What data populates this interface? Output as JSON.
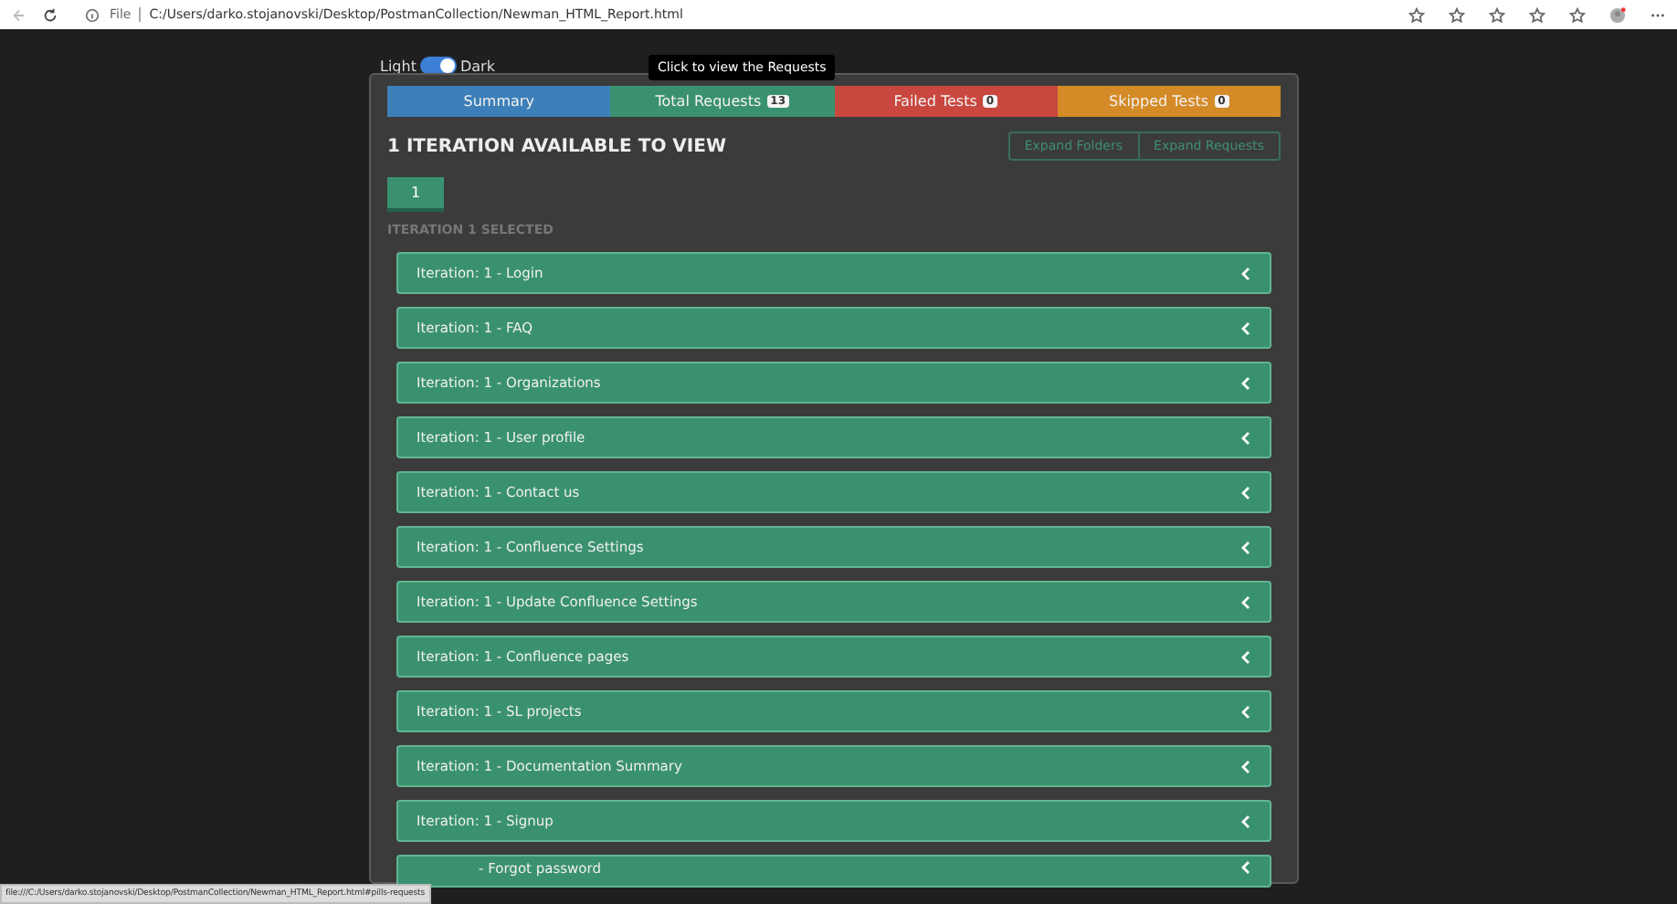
{
  "browser": {
    "file_label": "File",
    "url": "C:/Users/darko.stojanovski/Desktop/PostmanCollection/Newman_HTML_Report.html"
  },
  "theme_toggle": {
    "light_label": "Light",
    "dark_label": "Dark",
    "on": true
  },
  "tooltip": "Click to view the Requests",
  "tabs": [
    {
      "label": "Summary",
      "color": "#3d7fb8"
    },
    {
      "label": "Total Requests",
      "badge": "13",
      "color": "#3a9170"
    },
    {
      "label": "Failed Tests",
      "badge": "0",
      "color": "#c9473e"
    },
    {
      "label": "Skipped Tests",
      "badge": "0",
      "color": "#d48a26"
    }
  ],
  "heading": "1 ITERATION AVAILABLE TO VIEW",
  "expand_buttons": [
    "Expand Folders",
    "Expand Requests"
  ],
  "iterations": [
    {
      "label": "1",
      "selected": true
    }
  ],
  "selected_label": "ITERATION 1 SELECTED",
  "requests": [
    {
      "label": "Iteration: 1 - Login"
    },
    {
      "label": "Iteration: 1 - FAQ"
    },
    {
      "label": "Iteration: 1 - Organizations"
    },
    {
      "label": "Iteration: 1 - User profile"
    },
    {
      "label": "Iteration: 1 - Contact us"
    },
    {
      "label": "Iteration: 1 - Confluence Settings"
    },
    {
      "label": "Iteration: 1 - Update Confluence Settings"
    },
    {
      "label": "Iteration: 1 - Confluence pages"
    },
    {
      "label": "Iteration: 1 - SL projects"
    },
    {
      "label": "Iteration: 1 - Documentation Summary"
    },
    {
      "label": "Iteration: 1 - Signup"
    },
    {
      "label": "- Forgot password",
      "kind": "partial"
    }
  ],
  "status_url": "file:///C:/Users/darko.stojanovski/Desktop/PostmanCollection/Newman_HTML_Report.html#pills-requests"
}
